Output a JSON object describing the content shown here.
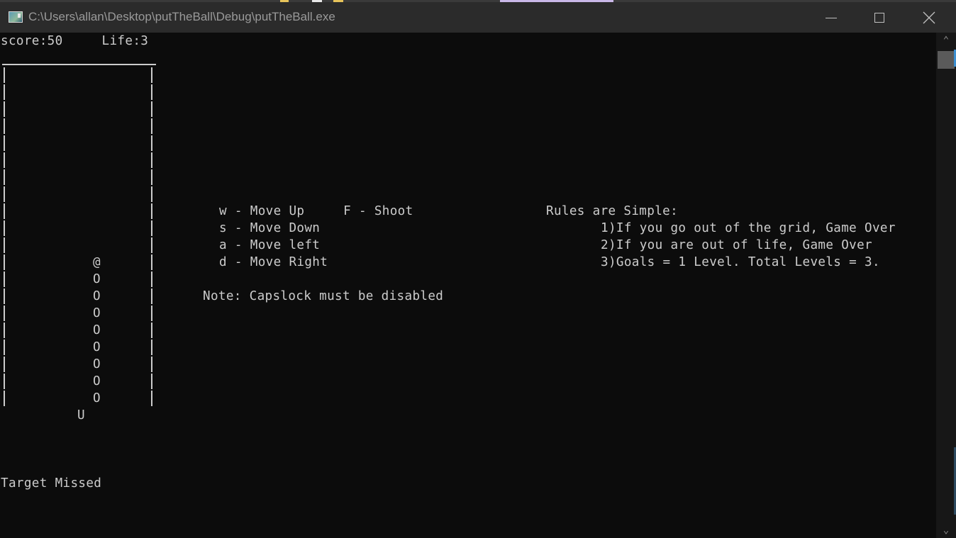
{
  "window": {
    "title": "C:\\Users\\allan\\Desktop\\putTheBall\\Debug\\putTheBall.exe",
    "icon": "console-app-icon",
    "controls": [
      "minimize",
      "maximize",
      "close"
    ]
  },
  "hud": {
    "score_label": "score:50",
    "life_label": "Life:3",
    "score": 50,
    "life": 3
  },
  "grid": {
    "player_glyph": "@",
    "trail_glyph": "O",
    "trail_count": 8,
    "goal_glyph": "U",
    "rows": 20
  },
  "controls_help": {
    "lines": [
      "w - Move Up     F - Shoot",
      "s - Move Down",
      "a - Move left",
      "d - Move Right"
    ],
    "note": "Note: Capslock must be disabled"
  },
  "rules": {
    "title": "Rules are Simple:",
    "items": [
      "1)If you go out of the grid, Game Over",
      "2)If you are out of life, Game Over",
      "3)Goals = 1 Level. Total Levels = 3."
    ]
  },
  "status": {
    "message": "Target Missed"
  },
  "scrollbar": {
    "up": "▲",
    "down": "▼"
  }
}
